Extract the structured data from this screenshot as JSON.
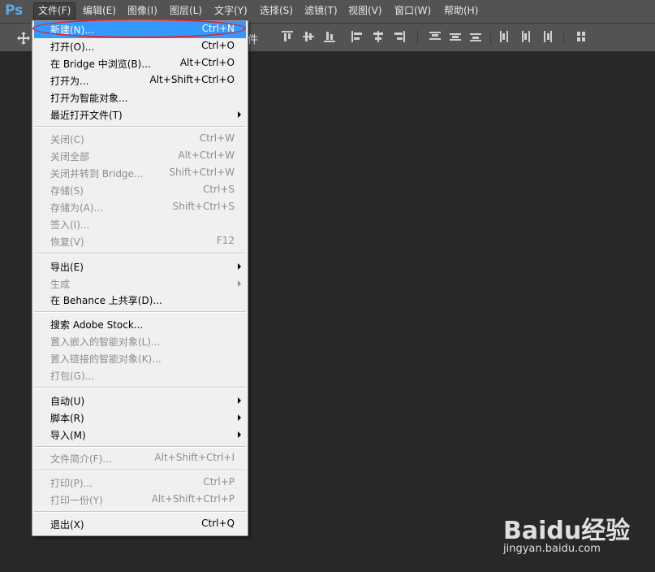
{
  "app": {
    "logo": "Ps"
  },
  "menubar": {
    "items": [
      {
        "label": "文件(F)"
      },
      {
        "label": "编辑(E)"
      },
      {
        "label": "图像(I)"
      },
      {
        "label": "图层(L)"
      },
      {
        "label": "文字(Y)"
      },
      {
        "label": "选择(S)"
      },
      {
        "label": "滤镜(T)"
      },
      {
        "label": "视图(V)"
      },
      {
        "label": "窗口(W)"
      },
      {
        "label": "帮助(H)"
      }
    ]
  },
  "options_bar": {
    "partial_label": "件",
    "icons": [
      "move-tool-icon",
      "align-top-icon",
      "align-vcenter-icon",
      "align-bottom-icon",
      "align-left-icon",
      "align-hcenter-icon",
      "align-right-icon",
      "distribute-top-icon",
      "distribute-vcenter-icon",
      "distribute-bottom-icon",
      "distribute-left-icon",
      "distribute-hcenter-icon",
      "distribute-right-icon",
      "auto-align-icon"
    ]
  },
  "file_menu": {
    "items": [
      {
        "label": "新建(N)...",
        "shortcut": "Ctrl+N",
        "enabled": true,
        "highlight": true
      },
      {
        "label": "打开(O)...",
        "shortcut": "Ctrl+O",
        "enabled": true
      },
      {
        "label": "在 Bridge 中浏览(B)...",
        "shortcut": "Alt+Ctrl+O",
        "enabled": true
      },
      {
        "label": "打开为...",
        "shortcut": "Alt+Shift+Ctrl+O",
        "enabled": true
      },
      {
        "label": "打开为智能对象...",
        "shortcut": "",
        "enabled": true
      },
      {
        "label": "最近打开文件(T)",
        "shortcut": "",
        "enabled": true,
        "submenu": true
      },
      {
        "label": "关闭(C)",
        "shortcut": "Ctrl+W",
        "enabled": false
      },
      {
        "label": "关闭全部",
        "shortcut": "Alt+Ctrl+W",
        "enabled": false
      },
      {
        "label": "关闭并转到 Bridge...",
        "shortcut": "Shift+Ctrl+W",
        "enabled": false
      },
      {
        "label": "存储(S)",
        "shortcut": "Ctrl+S",
        "enabled": false
      },
      {
        "label": "存储为(A)...",
        "shortcut": "Shift+Ctrl+S",
        "enabled": false
      },
      {
        "label": "签入(I)...",
        "shortcut": "",
        "enabled": false
      },
      {
        "label": "恢复(V)",
        "shortcut": "F12",
        "enabled": false
      },
      {
        "label": "导出(E)",
        "shortcut": "",
        "enabled": true,
        "submenu": true
      },
      {
        "label": "生成",
        "shortcut": "",
        "enabled": false,
        "submenu": true
      },
      {
        "label": "在 Behance 上共享(D)...",
        "shortcut": "",
        "enabled": true
      },
      {
        "label": "搜索 Adobe Stock...",
        "shortcut": "",
        "enabled": true
      },
      {
        "label": "置入嵌入的智能对象(L)...",
        "shortcut": "",
        "enabled": false
      },
      {
        "label": "置入链接的智能对象(K)...",
        "shortcut": "",
        "enabled": false
      },
      {
        "label": "打包(G)...",
        "shortcut": "",
        "enabled": false
      },
      {
        "label": "自动(U)",
        "shortcut": "",
        "enabled": true,
        "submenu": true
      },
      {
        "label": "脚本(R)",
        "shortcut": "",
        "enabled": true,
        "submenu": true
      },
      {
        "label": "导入(M)",
        "shortcut": "",
        "enabled": true,
        "submenu": true
      },
      {
        "label": "文件简介(F)...",
        "shortcut": "Alt+Shift+Ctrl+I",
        "enabled": false
      },
      {
        "label": "打印(P)...",
        "shortcut": "Ctrl+P",
        "enabled": false
      },
      {
        "label": "打印一份(Y)",
        "shortcut": "Alt+Shift+Ctrl+P",
        "enabled": false
      },
      {
        "label": "退出(X)",
        "shortcut": "Ctrl+Q",
        "enabled": true
      }
    ]
  },
  "watermark": {
    "text": "Baidu经验",
    "url": "jingyan.baidu.com"
  }
}
